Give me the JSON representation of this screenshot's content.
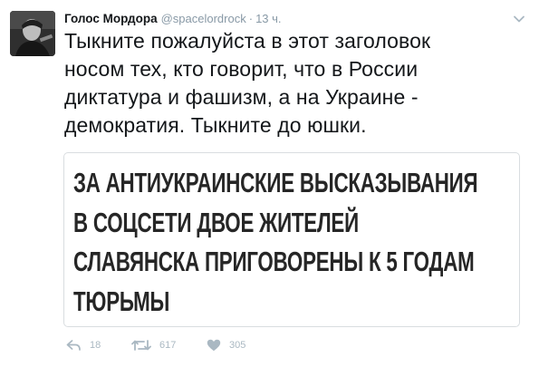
{
  "tweet": {
    "author": {
      "name": "Голос Мордора",
      "handle": "@spacelordrock",
      "separator": "·",
      "time": "13 ч."
    },
    "text_lines": [
      "Тыкните пожалуйста в этот заголовок",
      "носом тех, кто говорит, что в России",
      "диктатура и фашизм, а на Украине -",
      "демократия. Тыкните до юшки."
    ],
    "media": {
      "headline_lines": [
        "ЗА АНТИУКРАИНСКИЕ ВЫСКАЗЫВАНИЯ",
        "В СОЦСЕТИ ДВОЕ ЖИТЕЛЕЙ",
        "СЛАВЯНСКА ПРИГОВОРЕНЫ К 5 ГОДАМ",
        "ТЮРЬМЫ"
      ]
    },
    "actions": {
      "reply": {
        "icon": "reply-icon",
        "count": "18"
      },
      "retweet": {
        "icon": "retweet-icon",
        "count": "617"
      },
      "like": {
        "icon": "heart-icon",
        "count": "305"
      }
    },
    "menu_icon": "chevron-down-icon"
  },
  "colors": {
    "text": "#14171a",
    "muted": "#8899a6",
    "action_icons": "#aab8c2",
    "card_border": "#d9dde0",
    "headline": "#262626"
  }
}
